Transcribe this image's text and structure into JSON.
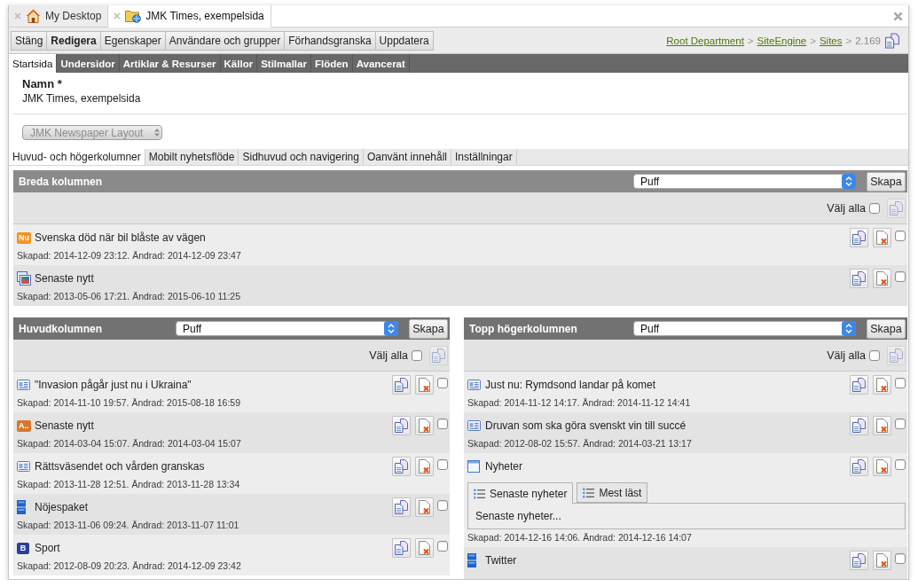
{
  "tabs": [
    {
      "label": "My Desktop",
      "kind": "home",
      "selected": false
    },
    {
      "label": "JMK Times, exempelsida",
      "kind": "site",
      "selected": true
    }
  ],
  "toolbar": {
    "buttons": [
      {
        "label": "Stäng",
        "selected": false
      },
      {
        "label": "Redigera",
        "selected": true
      },
      {
        "label": "Egenskaper",
        "selected": false
      },
      {
        "label": "Användare och grupper",
        "selected": false
      },
      {
        "label": "Förhandsgranska",
        "selected": false
      },
      {
        "label": "Uppdatera",
        "selected": false
      }
    ],
    "breadcrumb": [
      {
        "kind": "link",
        "label": "Root Department"
      },
      {
        "kind": "separator",
        "label": ">"
      },
      {
        "kind": "link",
        "label": "SiteEngine"
      },
      {
        "kind": "separator",
        "label": ">"
      },
      {
        "kind": "link",
        "label": "Sites"
      },
      {
        "kind": "separator",
        "label": ">"
      },
      {
        "kind": "current",
        "label": "2.169"
      }
    ]
  },
  "nav_tabs": [
    {
      "label": "Startsida",
      "selected": true
    },
    {
      "label": "Undersidor",
      "selected": false
    },
    {
      "label": "Artiklar & Resurser",
      "selected": false
    },
    {
      "label": "Källor",
      "selected": false
    },
    {
      "label": "Stilmallar",
      "selected": false
    },
    {
      "label": "Flöden",
      "selected": false
    },
    {
      "label": "Avancerat",
      "selected": false
    }
  ],
  "name_field": {
    "label": "Namn *",
    "value": "JMK Times, exempelsida"
  },
  "layout_select": {
    "value": "JMK Newspaper Layout",
    "disabled": true
  },
  "sub_tabs": [
    {
      "label": "Huvud- och högerkolumner",
      "selected": true
    },
    {
      "label": "Mobilt nyhetsflöde",
      "selected": false
    },
    {
      "label": "Sidhuvud och navigering",
      "selected": false
    },
    {
      "label": "Oanvänt innehåll",
      "selected": false
    },
    {
      "label": "Inställningar",
      "selected": false
    }
  ],
  "wide_section": {
    "title": "Breda kolumnen",
    "select": "Puff",
    "create": "Skapa",
    "select_all": {
      "label": "Välj alla",
      "checked": false,
      "copy_disabled": true
    },
    "items": [
      {
        "kind": "badge",
        "badge": "Nu",
        "color": "#f7931e",
        "title": "Svenska död när bil blåste av vägen",
        "meta": "Skapad: 2014-12-09 23:12. Ändrad: 2014-12-09 23:47",
        "checked": false
      },
      {
        "kind": "gallery",
        "title": "Senaste nytt",
        "meta": "Skapad: 2013-05-06 17:21. Ändrad: 2015-06-10 11:25",
        "checked": false
      }
    ]
  },
  "columns": [
    {
      "title": "Huvudkolumnen",
      "select": "Puff",
      "create": "Skapa",
      "select_all": {
        "label": "Välj alla",
        "checked": false,
        "copy_disabled": true
      },
      "items": [
        {
          "kind": "article",
          "title": "\"Invasion pågår just nu i Ukraina\"",
          "meta": "Skapad: 2014-11-10 19:57. Ändrad: 2015-08-18 16:59",
          "checked": false
        },
        {
          "kind": "badge",
          "badge": "A..",
          "color": "#d8772c",
          "title": "Senaste nytt",
          "meta": "Skapad: 2014-03-04 15:07. Ändrad: 2014-03-04 15:07",
          "checked": false
        },
        {
          "kind": "article",
          "title": "Rättsväsendet och vården granskas",
          "meta": "Skapad: 2013-11-28 12:51. Ändrad: 2013-11-28 13:34",
          "checked": false
        },
        {
          "kind": "stack",
          "title": "Nöjespaket",
          "meta": "Skapad: 2013-11-06 09:24. Ändrad: 2013-11-07 11:01",
          "checked": false
        },
        {
          "kind": "badge",
          "badge": "B",
          "color": "#2b409c",
          "title": "Sport",
          "meta": "Skapad: 2012-08-09 20:23. Ändrad: 2014-12-09 23:42",
          "checked": false
        }
      ]
    },
    {
      "title": "Topp högerkolumnen",
      "select": "Puff",
      "create": "Skapa",
      "select_all": {
        "label": "Välj alla",
        "checked": false,
        "copy_disabled": true
      },
      "items": [
        {
          "kind": "article",
          "title": "Just nu: Rymdsond landar på komet",
          "meta": "Skapad: 2014-11-12 14:17. Ändrad: 2014-11-12 14:41",
          "checked": false
        },
        {
          "kind": "article",
          "title": "Druvan som ska göra svenskt vin till succé",
          "meta": "Skapad: 2012-08-02 15:57. Ändrad: 2014-03-21 13:17",
          "checked": false
        },
        {
          "kind": "window",
          "title": "Nyheter",
          "widget": {
            "tabs": [
              {
                "label": "Senaste nyheter",
                "selected": true
              },
              {
                "label": "Mest läst",
                "selected": false
              }
            ],
            "content": "Senaste nyheter..."
          },
          "meta": "Skapad: 2014-12-16 14:06. Ändrad: 2014-12-16 14:07",
          "checked": false
        },
        {
          "kind": "stack",
          "title": "Twitter",
          "checked": false
        }
      ]
    }
  ]
}
